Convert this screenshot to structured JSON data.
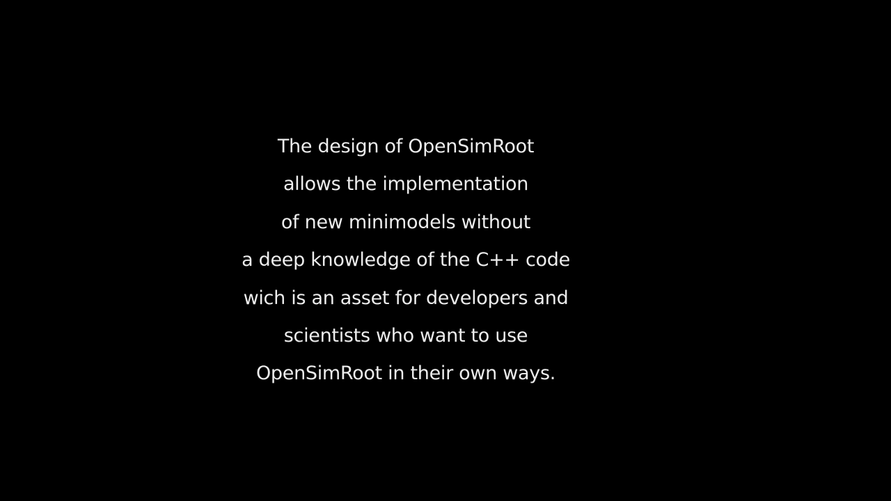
{
  "slide": {
    "background_color": "#000000",
    "text_color": "#ededed",
    "lines": [
      "The design of OpenSimRoot",
      "allows the implementation",
      "of new minimodels without",
      "a deep knowledge of the C++ code",
      "wich is an asset for developers and",
      "scientists who want to use",
      "OpenSimRoot in their own ways."
    ]
  }
}
